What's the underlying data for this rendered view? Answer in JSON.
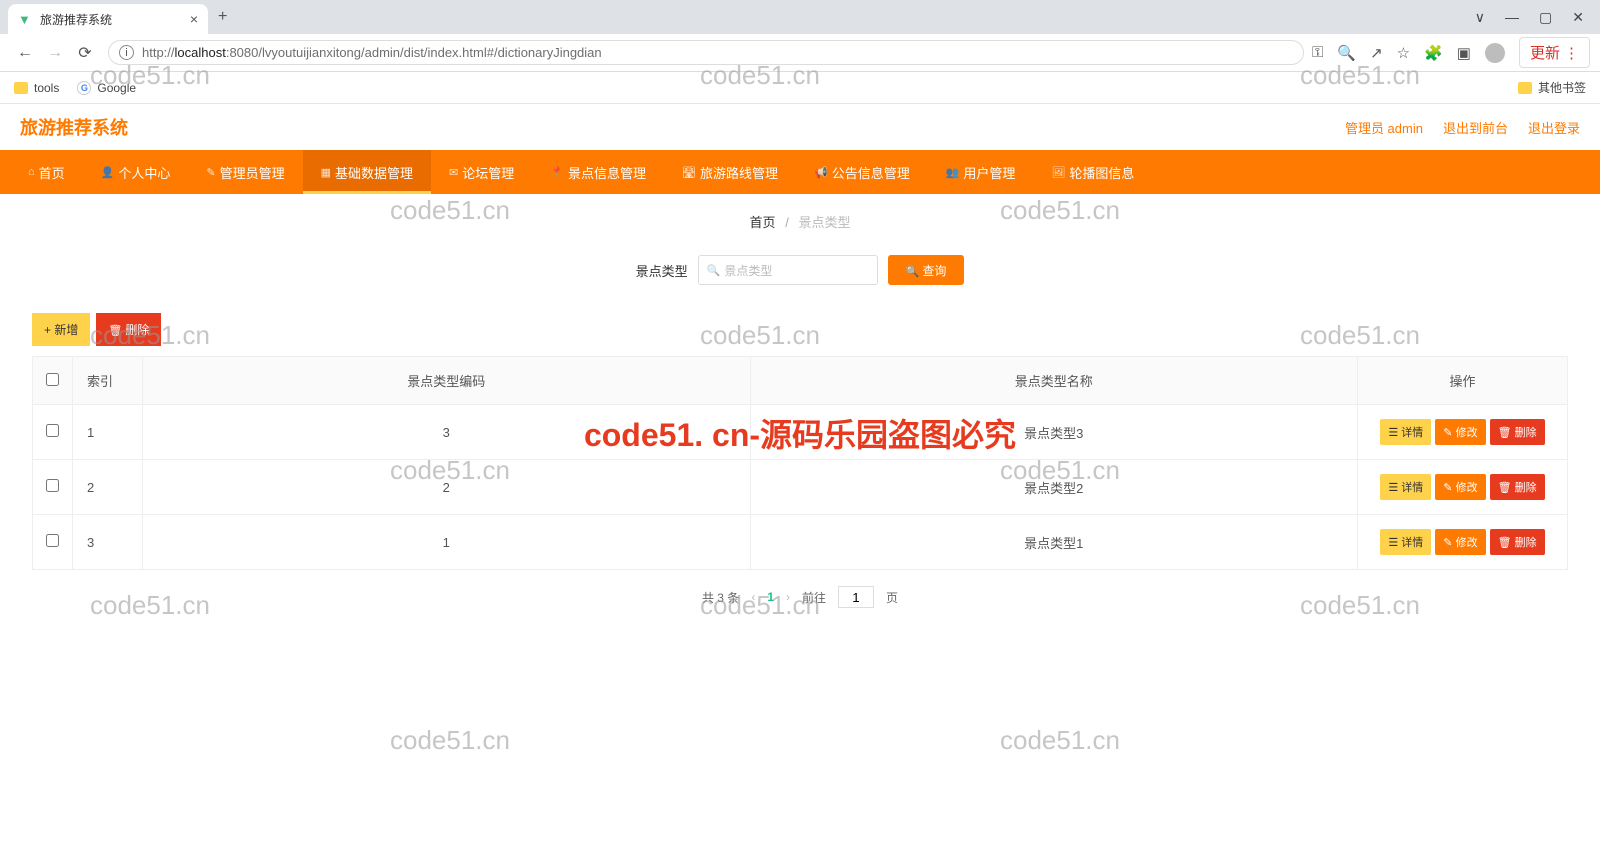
{
  "browser": {
    "tab_title": "旅游推荐系统",
    "url_host": "localhost",
    "url_port": ":8080",
    "url_path": "/lvyoutuijianxitong/admin/dist/index.html#/dictionaryJingdian",
    "update_label": "更新",
    "bookmarks": {
      "tools": "tools",
      "google": "Google"
    },
    "other_bookmarks": "其他书签"
  },
  "app": {
    "title": "旅游推荐系统",
    "header_right": {
      "user": "管理员 admin",
      "to_front": "退出到前台",
      "logout": "退出登录"
    }
  },
  "nav": {
    "items": [
      "首页",
      "个人中心",
      "管理员管理",
      "基础数据管理",
      "论坛管理",
      "景点信息管理",
      "旅游路线管理",
      "公告信息管理",
      "用户管理",
      "轮播图信息"
    ]
  },
  "breadcrumb": {
    "root": "首页",
    "current": "景点类型"
  },
  "search": {
    "label": "景点类型",
    "placeholder": "景点类型",
    "query_btn": "查询"
  },
  "toolbar": {
    "add": "新增",
    "del": "删除"
  },
  "table": {
    "headers": {
      "index": "索引",
      "code": "景点类型编码",
      "name": "景点类型名称",
      "ops": "操作"
    },
    "rows": [
      {
        "idx": "1",
        "code": "3",
        "name": "景点类型3"
      },
      {
        "idx": "2",
        "code": "2",
        "name": "景点类型2"
      },
      {
        "idx": "3",
        "code": "1",
        "name": "景点类型1"
      }
    ],
    "row_ops": {
      "detail": "详情",
      "edit": "修改",
      "delete": "删除"
    }
  },
  "pagination": {
    "total": "共 3 条",
    "page": "1",
    "goto_pre": "前往",
    "goto_val": "1",
    "goto_post": "页"
  },
  "watermark": {
    "text": "code51.cn",
    "red": "code51. cn-源码乐园盗图必究"
  }
}
